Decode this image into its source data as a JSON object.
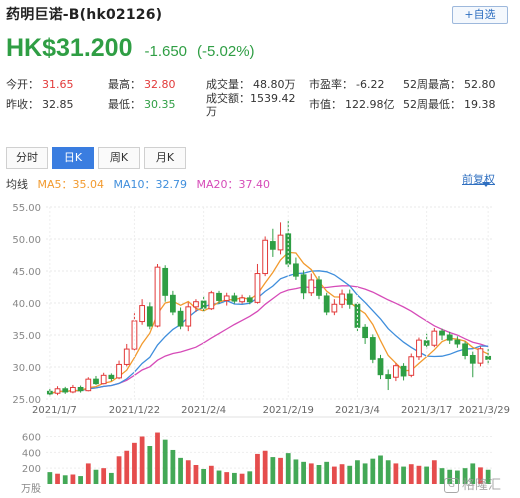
{
  "header": {
    "title": "药明巨诺-B(hk02126)",
    "watch_label": "+自选",
    "price": "HK$31.200",
    "change": "-1.650",
    "change_pct": "(-5.02%)"
  },
  "stats": [
    {
      "label": "今开：",
      "value": "31.65",
      "tone": "red"
    },
    {
      "label": "最高：",
      "value": "32.80",
      "tone": "red"
    },
    {
      "label": "成交量：",
      "value": "48.80万",
      "tone": "dark"
    },
    {
      "label": "市盈率：",
      "value": "-6.22",
      "tone": "dark"
    },
    {
      "label": "52周最高：",
      "value": "52.80",
      "tone": "dark"
    },
    {
      "label": "昨收：",
      "value": "32.85",
      "tone": "dark"
    },
    {
      "label": "最低：",
      "value": "30.35",
      "tone": "green"
    },
    {
      "label": "成交额：",
      "value": "1539.42万",
      "tone": "dark"
    },
    {
      "label": "市值：",
      "value": "122.98亿",
      "tone": "dark"
    },
    {
      "label": "52周最低：",
      "value": "19.38",
      "tone": "dark"
    }
  ],
  "tabs": [
    "分时",
    "日K",
    "周K",
    "月K"
  ],
  "active_tab": 1,
  "ma": {
    "label": "均线",
    "ma5": "MA5：35.04",
    "ma10": "MA10：32.79",
    "ma20": "MA20：37.40"
  },
  "adjust_label": "前复权",
  "watermark": "格隆汇",
  "watermark_logo": "G",
  "colors": {
    "up": "#e23a3a",
    "down": "#2f9e44",
    "ma5": "#f29a2e",
    "ma10": "#3f8edc",
    "ma20": "#d64bb8",
    "volume": "#e23a3a"
  },
  "chart_data": {
    "type": "candlestick",
    "price_axis": {
      "ylim": [
        25,
        55
      ],
      "ticks": [
        "55.00",
        "50.00",
        "45.00",
        "40.00",
        "35.00",
        "30.00",
        "25.00"
      ]
    },
    "volume_axis": {
      "ylim": [
        0,
        720
      ],
      "ticks": [
        "600",
        "400",
        "200"
      ],
      "unit": "万股"
    },
    "x_tick_labels": [
      "2021/1/7",
      "2021/1/22",
      "2021/2/4",
      "2021/2/19",
      "2021/3/4",
      "2021/3/17",
      "2021/3/29"
    ],
    "x_tick_index": [
      0,
      11,
      20,
      31,
      40,
      49,
      57
    ],
    "candles": [
      {
        "o": 26.2,
        "c": 25.8,
        "h": 26.6,
        "l": 25.4,
        "v": 150
      },
      {
        "o": 25.9,
        "c": 26.6,
        "h": 27.0,
        "l": 25.6,
        "v": 130
      },
      {
        "o": 26.6,
        "c": 26.1,
        "h": 26.9,
        "l": 25.8,
        "v": 110
      },
      {
        "o": 26.1,
        "c": 26.8,
        "h": 27.2,
        "l": 25.9,
        "v": 120
      },
      {
        "o": 26.8,
        "c": 26.3,
        "h": 27.1,
        "l": 26.0,
        "v": 100
      },
      {
        "o": 26.3,
        "c": 28.1,
        "h": 28.4,
        "l": 26.2,
        "v": 260
      },
      {
        "o": 28.1,
        "c": 27.4,
        "h": 28.6,
        "l": 27.2,
        "v": 180
      },
      {
        "o": 27.4,
        "c": 28.7,
        "h": 29.1,
        "l": 27.3,
        "v": 200
      },
      {
        "o": 28.7,
        "c": 28.2,
        "h": 29.0,
        "l": 27.8,
        "v": 140
      },
      {
        "o": 28.3,
        "c": 30.4,
        "h": 31.0,
        "l": 28.1,
        "v": 350
      },
      {
        "o": 30.4,
        "c": 32.8,
        "h": 33.6,
        "l": 30.1,
        "v": 420
      },
      {
        "o": 32.8,
        "c": 37.2,
        "h": 38.4,
        "l": 32.6,
        "v": 520
      },
      {
        "o": 37.1,
        "c": 39.6,
        "h": 40.6,
        "l": 36.6,
        "v": 600
      },
      {
        "o": 39.4,
        "c": 36.4,
        "h": 40.1,
        "l": 35.9,
        "v": 480
      },
      {
        "o": 36.4,
        "c": 45.6,
        "h": 46.1,
        "l": 36.2,
        "v": 650
      },
      {
        "o": 45.4,
        "c": 41.2,
        "h": 45.9,
        "l": 40.2,
        "v": 560
      },
      {
        "o": 41.2,
        "c": 38.6,
        "h": 41.9,
        "l": 38.1,
        "v": 430
      },
      {
        "o": 38.7,
        "c": 36.4,
        "h": 39.3,
        "l": 35.9,
        "v": 330
      },
      {
        "o": 36.4,
        "c": 39.4,
        "h": 40.1,
        "l": 35.6,
        "v": 300
      },
      {
        "o": 39.4,
        "c": 40.2,
        "h": 40.6,
        "l": 38.6,
        "v": 240
      },
      {
        "o": 40.3,
        "c": 39.2,
        "h": 41.1,
        "l": 38.6,
        "v": 190
      },
      {
        "o": 39.1,
        "c": 41.6,
        "h": 41.9,
        "l": 38.9,
        "v": 230
      },
      {
        "o": 41.5,
        "c": 40.4,
        "h": 41.9,
        "l": 39.9,
        "v": 170
      },
      {
        "o": 40.4,
        "c": 41.1,
        "h": 41.6,
        "l": 39.6,
        "v": 150
      },
      {
        "o": 41.1,
        "c": 40.3,
        "h": 41.6,
        "l": 39.9,
        "v": 140
      },
      {
        "o": 40.2,
        "c": 40.8,
        "h": 41.3,
        "l": 39.9,
        "v": 130
      },
      {
        "o": 40.8,
        "c": 40.2,
        "h": 41.2,
        "l": 39.8,
        "v": 160
      },
      {
        "o": 40.1,
        "c": 44.6,
        "h": 46.1,
        "l": 39.9,
        "v": 380
      },
      {
        "o": 44.6,
        "c": 49.8,
        "h": 50.4,
        "l": 44.2,
        "v": 420
      },
      {
        "o": 49.6,
        "c": 48.4,
        "h": 51.6,
        "l": 47.2,
        "v": 340
      },
      {
        "o": 48.3,
        "c": 50.6,
        "h": 52.6,
        "l": 47.6,
        "v": 330
      },
      {
        "o": 50.8,
        "c": 46.1,
        "h": 52.8,
        "l": 45.6,
        "v": 390
      },
      {
        "o": 46.1,
        "c": 44.2,
        "h": 47.1,
        "l": 43.6,
        "v": 310
      },
      {
        "o": 44.4,
        "c": 41.6,
        "h": 45.1,
        "l": 40.6,
        "v": 280
      },
      {
        "o": 41.6,
        "c": 43.6,
        "h": 44.6,
        "l": 41.1,
        "v": 260
      },
      {
        "o": 43.6,
        "c": 41.2,
        "h": 44.2,
        "l": 40.6,
        "v": 240
      },
      {
        "o": 41.1,
        "c": 38.6,
        "h": 41.6,
        "l": 38.1,
        "v": 280
      },
      {
        "o": 38.6,
        "c": 39.8,
        "h": 40.6,
        "l": 38.1,
        "v": 220
      },
      {
        "o": 39.8,
        "c": 41.4,
        "h": 42.1,
        "l": 39.2,
        "v": 250
      },
      {
        "o": 41.4,
        "c": 39.8,
        "h": 42.1,
        "l": 39.1,
        "v": 230
      },
      {
        "o": 39.8,
        "c": 36.2,
        "h": 40.1,
        "l": 35.6,
        "v": 300
      },
      {
        "o": 36.2,
        "c": 34.6,
        "h": 36.7,
        "l": 33.6,
        "v": 260
      },
      {
        "o": 34.6,
        "c": 31.2,
        "h": 35.1,
        "l": 30.6,
        "v": 320
      },
      {
        "o": 31.3,
        "c": 28.8,
        "h": 31.9,
        "l": 28.1,
        "v": 360
      },
      {
        "o": 28.8,
        "c": 28.2,
        "h": 29.6,
        "l": 26.4,
        "v": 300
      },
      {
        "o": 28.4,
        "c": 30.2,
        "h": 30.6,
        "l": 27.8,
        "v": 260
      },
      {
        "o": 30.1,
        "c": 28.6,
        "h": 30.6,
        "l": 27.9,
        "v": 220
      },
      {
        "o": 28.7,
        "c": 31.6,
        "h": 32.1,
        "l": 28.4,
        "v": 250
      },
      {
        "o": 31.6,
        "c": 34.2,
        "h": 34.6,
        "l": 31.1,
        "v": 230
      },
      {
        "o": 34.1,
        "c": 33.4,
        "h": 35.2,
        "l": 32.8,
        "v": 220
      },
      {
        "o": 33.4,
        "c": 35.6,
        "h": 36.1,
        "l": 33.1,
        "v": 300
      },
      {
        "o": 35.6,
        "c": 35.0,
        "h": 36.0,
        "l": 34.2,
        "v": 200
      },
      {
        "o": 35.0,
        "c": 34.2,
        "h": 35.5,
        "l": 33.6,
        "v": 180
      },
      {
        "o": 34.2,
        "c": 33.6,
        "h": 34.8,
        "l": 33.0,
        "v": 170
      },
      {
        "o": 33.6,
        "c": 31.8,
        "h": 34.0,
        "l": 31.2,
        "v": 200
      },
      {
        "o": 31.8,
        "c": 30.6,
        "h": 32.4,
        "l": 28.4,
        "v": 260
      },
      {
        "o": 30.6,
        "c": 32.85,
        "h": 33.2,
        "l": 30.1,
        "v": 210
      },
      {
        "o": 31.65,
        "c": 31.2,
        "h": 32.8,
        "l": 30.35,
        "v": 180
      }
    ]
  }
}
